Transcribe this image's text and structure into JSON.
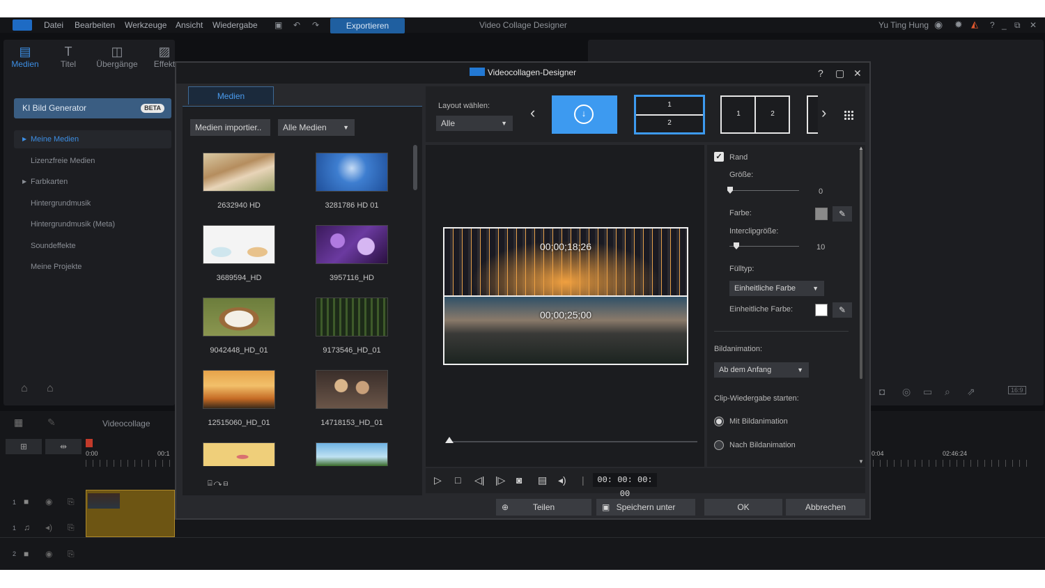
{
  "menubar": {
    "items": [
      "Datei",
      "Bearbeiten",
      "Werkzeuge",
      "Ansicht",
      "Wiedergabe"
    ],
    "export_label": "Exportieren",
    "project_title": "Video Collage Designer",
    "user_name": "Yu Ting Hung"
  },
  "left_panel": {
    "tabs": [
      "Medien",
      "Titel",
      "Übergänge",
      "Effekt"
    ],
    "ai_button": "KI Bild Generator",
    "beta_badge": "BETA",
    "library": [
      "Meine Medien",
      "Lizenzfreie Medien",
      "Farbkarten",
      "Hintergrundmusik",
      "Hintergrundmusik (Meta)",
      "Soundeffekte",
      "Meine Projekte"
    ]
  },
  "timeline": {
    "label": "Videocollage",
    "ruler_start": "0:00",
    "ruler_partial": "00:1",
    "ruler_right_1": "0:04",
    "ruler_right_2": "02:46:24",
    "track_numbers": [
      "1",
      "1",
      "2"
    ],
    "aspect_badge": "16:9"
  },
  "dialog": {
    "title": "Videocollagen-Designer",
    "help": "?",
    "media_tab": "Medien",
    "import_button": "Medien importier..",
    "filter": "Alle Medien",
    "media_items": [
      {
        "label": "2632940 HD"
      },
      {
        "label": "3281786 HD 01"
      },
      {
        "label": "3689594_HD"
      },
      {
        "label": "3957116_HD"
      },
      {
        "label": "9042448_HD_01"
      },
      {
        "label": "9173546_HD_01"
      },
      {
        "label": "12515060_HD_01"
      },
      {
        "label": "14718153_HD_01"
      }
    ],
    "layout_label": "Layout wählen:",
    "layout_filter": "Alle",
    "layout_cells_selected": [
      "1",
      "2"
    ],
    "layout_cells_next": [
      "1",
      "2"
    ],
    "collage_timecodes": [
      "00;00;18;26",
      "00;00;25;00"
    ],
    "props": {
      "border_label": "Rand",
      "border_checked": true,
      "size_label": "Größe:",
      "size_value": "0",
      "color_label": "Farbe:",
      "interclip_label": "Interclipgröße:",
      "interclip_value": "10",
      "fill_type_label": "Fülltyp:",
      "fill_type_value": "Einheitliche Farbe",
      "uniform_color_label": "Einheitliche Farbe:",
      "animation_label": "Bildanimation:",
      "animation_value": "Ab dem Anfang",
      "playback_label": "Clip-Wiedergabe starten:",
      "radio_with": "Mit Bildanimation",
      "radio_after": "Nach Bildanimation",
      "border_color": "#8a8a8a",
      "uniform_color": "#ffffff"
    },
    "playback_timecode": "00: 00: 00: 00",
    "buttons": {
      "share": "Teilen",
      "save_as": "Speichern unter",
      "ok": "OK",
      "cancel": "Abbrechen"
    }
  }
}
